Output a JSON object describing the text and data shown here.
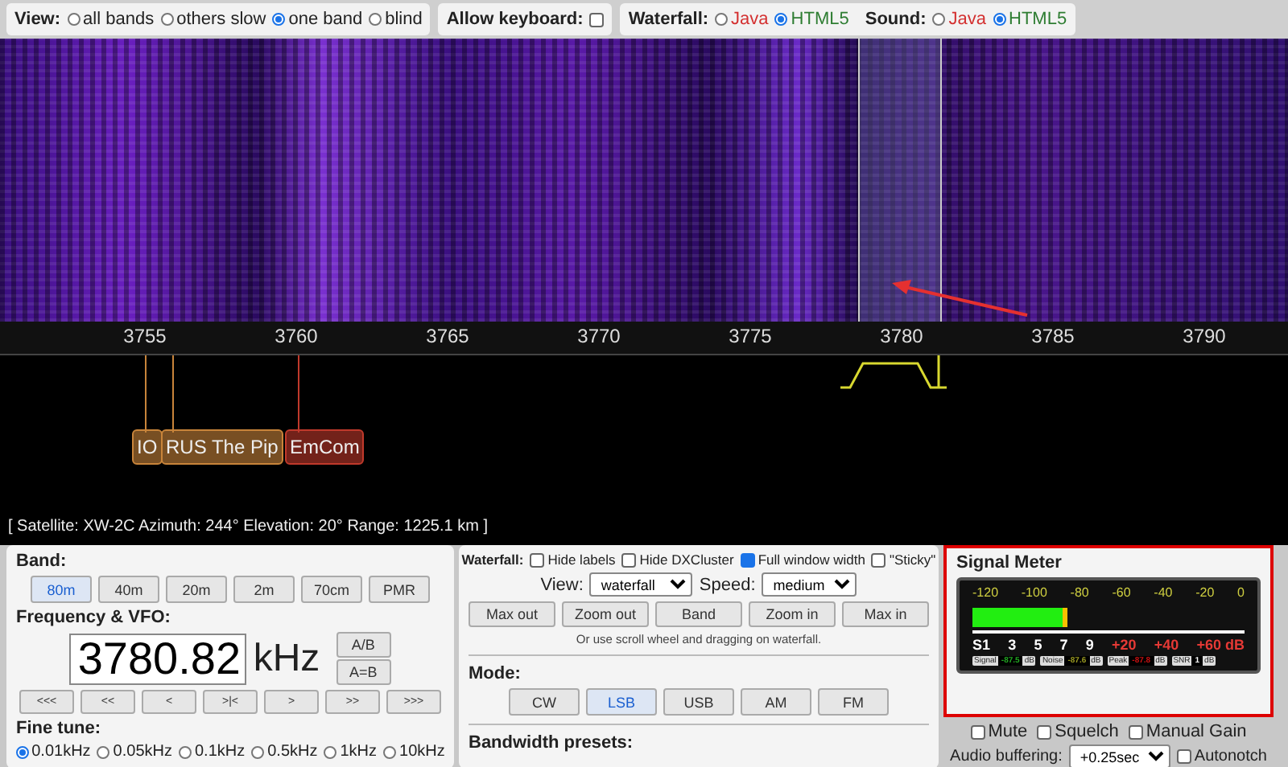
{
  "top_bar": {
    "view": {
      "label": "View:",
      "options": [
        {
          "label": "all bands",
          "selected": false
        },
        {
          "label": "others slow",
          "selected": false
        },
        {
          "label": "one band",
          "selected": true
        },
        {
          "label": "blind",
          "selected": false
        }
      ]
    },
    "keyboard": {
      "label": "Allow keyboard:",
      "checked": false
    },
    "waterfall": {
      "label": "Waterfall:",
      "options": [
        {
          "label": "Java",
          "selected": false,
          "color": "#d32f2f"
        },
        {
          "label": "HTML5",
          "selected": true,
          "color": "#2e7d32"
        }
      ]
    },
    "sound": {
      "label": "Sound:",
      "options": [
        {
          "label": "Java",
          "selected": false,
          "color": "#d32f2f"
        },
        {
          "label": "HTML5",
          "selected": true,
          "color": "#2e7d32"
        }
      ]
    }
  },
  "spectrum": {
    "scale": [
      "3755",
      "3760",
      "3765",
      "3770",
      "3775",
      "3780",
      "3785",
      "3790"
    ],
    "markers": [
      {
        "label": "IO",
        "color": "#c8843a"
      },
      {
        "label": "RUS The Pip",
        "color": "#c8843a"
      },
      {
        "label": "EmCom",
        "color": "#c0392b"
      }
    ],
    "status": "[ Satellite: XW-2C Azimuth: 244° Elevation: 20° Range: 1225.1 km ]"
  },
  "band_panel": {
    "band_label": "Band:",
    "bands": [
      {
        "label": "80m",
        "selected": true
      },
      {
        "label": "40m",
        "selected": false
      },
      {
        "label": "20m",
        "selected": false
      },
      {
        "label": "2m",
        "selected": false
      },
      {
        "label": "70cm",
        "selected": false
      },
      {
        "label": "PMR",
        "selected": false
      }
    ],
    "freq_label": "Frequency & VFO:",
    "frequency": "3780.82",
    "unit": "kHz",
    "vfo_buttons": [
      "A/B",
      "A=B"
    ],
    "steps": [
      "<<<",
      "<<",
      "<",
      ">|<",
      ">",
      ">>",
      ">>>"
    ],
    "fine_label": "Fine tune:",
    "fine": [
      {
        "label": "0.01kHz",
        "selected": true
      },
      {
        "label": "0.05kHz",
        "selected": false
      },
      {
        "label": "0.1kHz",
        "selected": false
      },
      {
        "label": "0.5kHz",
        "selected": false
      },
      {
        "label": "1kHz",
        "selected": false
      },
      {
        "label": "10kHz",
        "selected": false
      }
    ]
  },
  "waterfall_panel": {
    "label": "Waterfall:",
    "options": [
      {
        "label": "Hide labels",
        "checked": false
      },
      {
        "label": "Hide DXCluster",
        "checked": false
      },
      {
        "label": "Full window width",
        "checked": true
      },
      {
        "label": "\"Sticky\"",
        "checked": false
      }
    ],
    "view_label": "View:",
    "view_value": "waterfall",
    "speed_label": "Speed:",
    "speed_value": "medium",
    "zoom_buttons": [
      "Max out",
      "Zoom out",
      "Band",
      "Zoom in",
      "Max in"
    ],
    "hint": "Or use scroll wheel and dragging on waterfall.",
    "mode_label": "Mode:",
    "modes": [
      {
        "label": "CW",
        "selected": false
      },
      {
        "label": "LSB",
        "selected": true
      },
      {
        "label": "USB",
        "selected": false
      },
      {
        "label": "AM",
        "selected": false
      },
      {
        "label": "FM",
        "selected": false
      }
    ],
    "bandwidth_label": "Bandwidth presets:"
  },
  "signal_meter": {
    "title": "Signal Meter",
    "top_scale": [
      "-120",
      "-100",
      "-80",
      "-60",
      "-40",
      "-20",
      "0"
    ],
    "bottom_scale": [
      {
        "label": "S1",
        "color": "#ffffff"
      },
      {
        "label": "3",
        "color": "#ffffff"
      },
      {
        "label": "5",
        "color": "#ffffff"
      },
      {
        "label": "7",
        "color": "#ffffff"
      },
      {
        "label": "9",
        "color": "#ffffff"
      },
      {
        "label": "+20",
        "color": "#e53935"
      },
      {
        "label": "+40",
        "color": "#e53935"
      },
      {
        "label": "+60 dB",
        "color": "#e53935"
      }
    ],
    "level": 0.33,
    "readouts": [
      {
        "label": "Signal",
        "value": "-87.5",
        "unit": "dB",
        "color": "#22aa22"
      },
      {
        "label": "Noise",
        "value": "-87.6",
        "unit": "dB",
        "color": "#9a9a22"
      },
      {
        "label": "Peak",
        "value": "-87.8",
        "unit": "dB",
        "color": "#cc1111"
      },
      {
        "label": "SNR",
        "value": "1",
        "unit": "dB",
        "color": "#000000"
      }
    ]
  },
  "audio": {
    "options": [
      {
        "label": "Mute",
        "checked": false
      },
      {
        "label": "Squelch",
        "checked": false
      },
      {
        "label": "Manual Gain",
        "checked": false
      }
    ],
    "buffer_label": "Audio buffering:",
    "buffer_value": "+0.25sec",
    "autonotch": {
      "label": "Autonotch",
      "checked": false
    }
  }
}
